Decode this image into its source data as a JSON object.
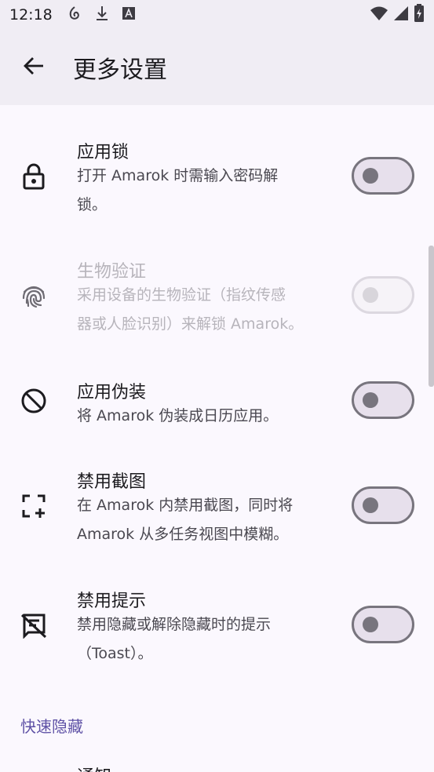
{
  "status_bar": {
    "time": "12:18",
    "icons": [
      "swirl-icon",
      "download-icon",
      "a-box-icon",
      "wifi-icon",
      "signal-icon",
      "battery-icon"
    ]
  },
  "top_bar": {
    "title": "更多设置",
    "back_icon": "arrow-back-icon"
  },
  "settings": [
    {
      "title": "应用锁",
      "summary_lines": [
        "打开 Amarok 时需输入密码解",
        "锁。"
      ],
      "icon": "lock-icon",
      "enabled": true,
      "checked": false
    },
    {
      "title": "生物验证",
      "summary_lines": [
        "采用设备的生物验证（指纹传感",
        "器或人脸识别）来解锁 Amarok。"
      ],
      "icon": "fingerprint-icon",
      "enabled": false,
      "checked": false
    },
    {
      "title": "应用伪装",
      "summary_lines": [
        "将 Amarok 伪装成日历应用。"
      ],
      "icon": "block-icon",
      "enabled": true,
      "checked": false
    },
    {
      "title": "禁用截图",
      "summary_lines": [
        "在 Amarok 内禁用截图，同时将",
        "Amarok 从多任务视图中模糊。"
      ],
      "icon": "screenshot-icon",
      "enabled": true,
      "checked": false
    },
    {
      "title": "禁用提示",
      "summary_lines": [
        "禁用隐藏或解除隐藏时的提示",
        "（Toast）。"
      ],
      "icon": "no-message-icon",
      "enabled": true,
      "checked": false
    }
  ],
  "section": {
    "title": "快速隐藏"
  },
  "partial_item": {
    "title": "通知"
  },
  "colors": {
    "accent": "#5f52a6",
    "surface": "#fbf8fe",
    "top_bar": "#f0edf4"
  }
}
